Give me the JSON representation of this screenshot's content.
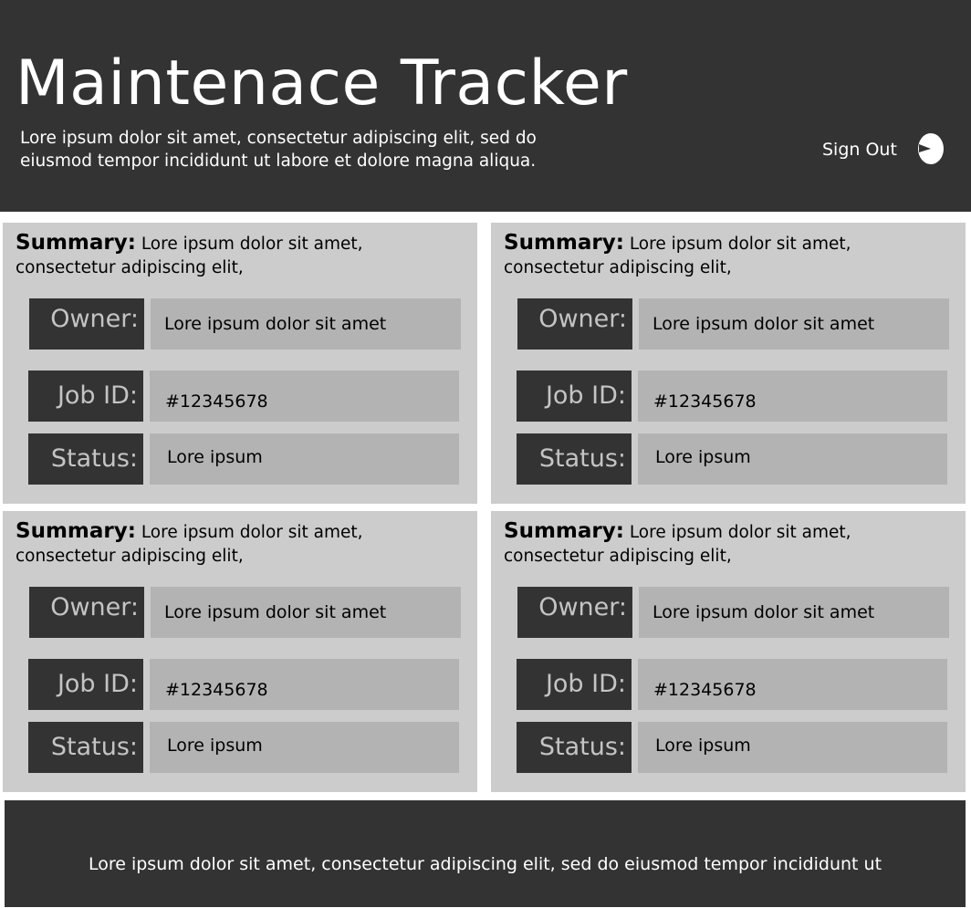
{
  "header": {
    "title": "Maintenace Tracker",
    "subtitle_line1": "Lore ipsum dolor sit amet, consectetur adipiscing elit, sed do",
    "subtitle_line2": "eiusmod tempor incididunt ut labore et dolore magna aliqua.",
    "sign_out_label": "Sign Out",
    "sign_out_icon": "power-icon"
  },
  "cards": [
    {
      "summary_label": "Summary:",
      "summary_text": "Lore ipsum dolor sit amet, consectetur adipiscing elit,",
      "owner_label": "Owner:",
      "owner_value": "Lore ipsum dolor sit amet",
      "job_label": "Job ID:",
      "job_value": "#12345678",
      "status_label": "Status:",
      "status_value": "Lore ipsum"
    },
    {
      "summary_label": "Summary:",
      "summary_text": "Lore ipsum dolor sit amet, consectetur adipiscing elit,",
      "owner_label": "Owner:",
      "owner_value": "Lore ipsum dolor sit amet",
      "job_label": "Job ID:",
      "job_value": "#12345678",
      "status_label": "Status:",
      "status_value": "Lore ipsum"
    },
    {
      "summary_label": "Summary:",
      "summary_text": "Lore ipsum dolor sit amet, consectetur adipiscing elit,",
      "owner_label": "Owner:",
      "owner_value": "Lore ipsum dolor sit amet",
      "job_label": "Job ID:",
      "job_value": "#12345678",
      "status_label": "Status:",
      "status_value": "Lore ipsum"
    },
    {
      "summary_label": "Summary:",
      "summary_text": "Lore ipsum dolor sit amet, consectetur adipiscing elit,",
      "owner_label": "Owner:",
      "owner_value": "Lore ipsum dolor sit amet",
      "job_label": "Job ID:",
      "job_value": "#12345678",
      "status_label": "Status:",
      "status_value": "Lore ipsum"
    }
  ],
  "footer": {
    "text": "Lore ipsum dolor sit amet, consectetur adipiscing elit, sed do eiusmod tempor incididunt ut"
  },
  "colors": {
    "header_bg": "#333333",
    "card_bg": "#cccccc",
    "label_bg": "#333333",
    "label_text": "#c4c4c4",
    "value_bg": "#b3b3b3",
    "page_bg": "#ffffff"
  }
}
